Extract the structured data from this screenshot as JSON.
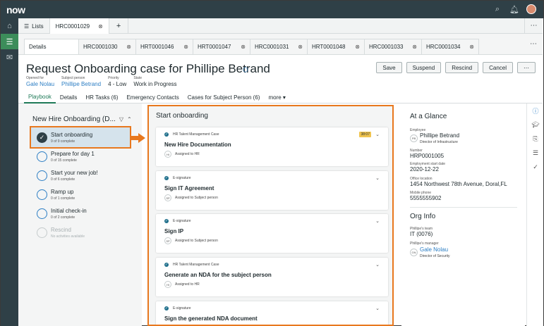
{
  "app": {
    "logo": "now"
  },
  "nav_tabs": {
    "lists": "Lists",
    "active_record": "HRC0001029",
    "more": "⋯"
  },
  "record_tabs": [
    {
      "label": "Details"
    },
    {
      "label": "HRC0001030"
    },
    {
      "label": "HRT0001046"
    },
    {
      "label": "HRT0001047"
    },
    {
      "label": "HRC0001031"
    },
    {
      "label": "HRT0001048"
    },
    {
      "label": "HRC0001033"
    },
    {
      "label": "HRC0001034"
    }
  ],
  "header": {
    "title": "Request Onboarding case for Phillipe Betrand",
    "meta": {
      "opened_for_label": "Opened for",
      "opened_for": "Gale Nolau",
      "subject_label": "Subject person",
      "subject": "Phillipe Betrand",
      "priority_label": "Priority",
      "priority": "4 - Low",
      "state_label": "State",
      "state": "Work in Progress"
    },
    "actions": {
      "save": "Save",
      "suspend": "Suspend",
      "rescind": "Rescind",
      "cancel": "Cancel",
      "more": "⋯"
    }
  },
  "sub_tabs": [
    {
      "label": "Playbook"
    },
    {
      "label": "Details"
    },
    {
      "label": "HR Tasks (6)"
    },
    {
      "label": "Emergency Contacts"
    },
    {
      "label": "Cases for Subject Person (6)"
    },
    {
      "label": "more ▾"
    }
  ],
  "playbook": {
    "title": "New Hire Onboarding (D...",
    "stages": [
      {
        "title": "Start onboarding",
        "subtitle": "9 of 9 complete"
      },
      {
        "title": "Prepare for day 1",
        "subtitle": "0 of 15 complete"
      },
      {
        "title": "Start your new job!",
        "subtitle": "0 of 6 complete"
      },
      {
        "title": "Ramp up",
        "subtitle": "0 of 1 complete"
      },
      {
        "title": "Initial check-in",
        "subtitle": "0 of 2 complete"
      },
      {
        "title": "Rescind",
        "subtitle": "No activities available"
      }
    ]
  },
  "activity": {
    "title": "Start onboarding",
    "cards": [
      {
        "type": "HR Talent Management Case",
        "title": "New Hire Documentation",
        "assignee_initials": "HI",
        "assigned": "Assigned to HR",
        "timer": "38:07"
      },
      {
        "type": "E-signature",
        "title": "Sign IT Agreement",
        "assignee_initials": "SP",
        "assigned": "Assigned to Subject person"
      },
      {
        "type": "E-signature",
        "title": "Sign IP",
        "assignee_initials": "SP",
        "assigned": "Assigned to Subject person"
      },
      {
        "type": "HR Talent Management Case",
        "title": "Generate an NDA for the subject person",
        "assignee_initials": "HI",
        "assigned": "Assigned to HR"
      },
      {
        "type": "E-signature",
        "title": "Sign the generated NDA document"
      }
    ]
  },
  "glance": {
    "title": "At a Glance",
    "employee_label": "Employee",
    "employee_initials": "PB",
    "employee_name": "Phillipe Betrand",
    "employee_title": "Director of Infrastructure",
    "number_label": "Number",
    "number": "HRP0001005",
    "start_label": "Employment start date",
    "start": "2020-12-22",
    "office_label": "Office location",
    "office": "1454 Northwest 78th Avenue, Doral,FL",
    "phone_label": "Mobile phone",
    "phone": "5555555902",
    "org_title": "Org Info",
    "team_label": "Phillipe's team",
    "team": "IT (0076)",
    "manager_label": "Phillipe's manager",
    "manager_initials": "GN",
    "manager_name": "Gale Nolau",
    "manager_title": "Director of Security"
  }
}
